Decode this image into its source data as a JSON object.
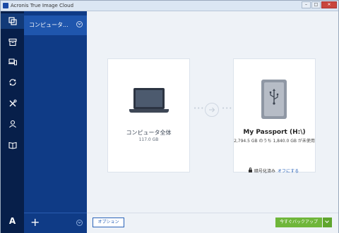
{
  "window": {
    "title": "Acronis True Image Cloud"
  },
  "rail": {
    "items": [
      {
        "icon": "backup-icon"
      },
      {
        "icon": "archive-icon"
      },
      {
        "icon": "devices-icon"
      },
      {
        "icon": "sync-icon"
      },
      {
        "icon": "tools-icon"
      },
      {
        "icon": "account-icon"
      },
      {
        "icon": "help-book-icon"
      }
    ],
    "bottom_logo": "A"
  },
  "backups": {
    "items": [
      {
        "label": "コンピュータ..."
      }
    ],
    "add_label": "+"
  },
  "source": {
    "title": "コンピュータ全体",
    "size": "117.0 GB"
  },
  "destination": {
    "title": "My Passport (H:\\)",
    "size": "2,794.5 GB のうち 1,840.0 GB が未使用"
  },
  "encryption": {
    "label": "暗号化済み",
    "link": "オフにする"
  },
  "footer": {
    "options_label": "オプション",
    "backup_label": "今すぐバックアップ"
  },
  "colors": {
    "rail": "#071f4a",
    "sidepanel": "#0f3b86",
    "accent": "#6fb63a",
    "link": "#2a63b8"
  }
}
